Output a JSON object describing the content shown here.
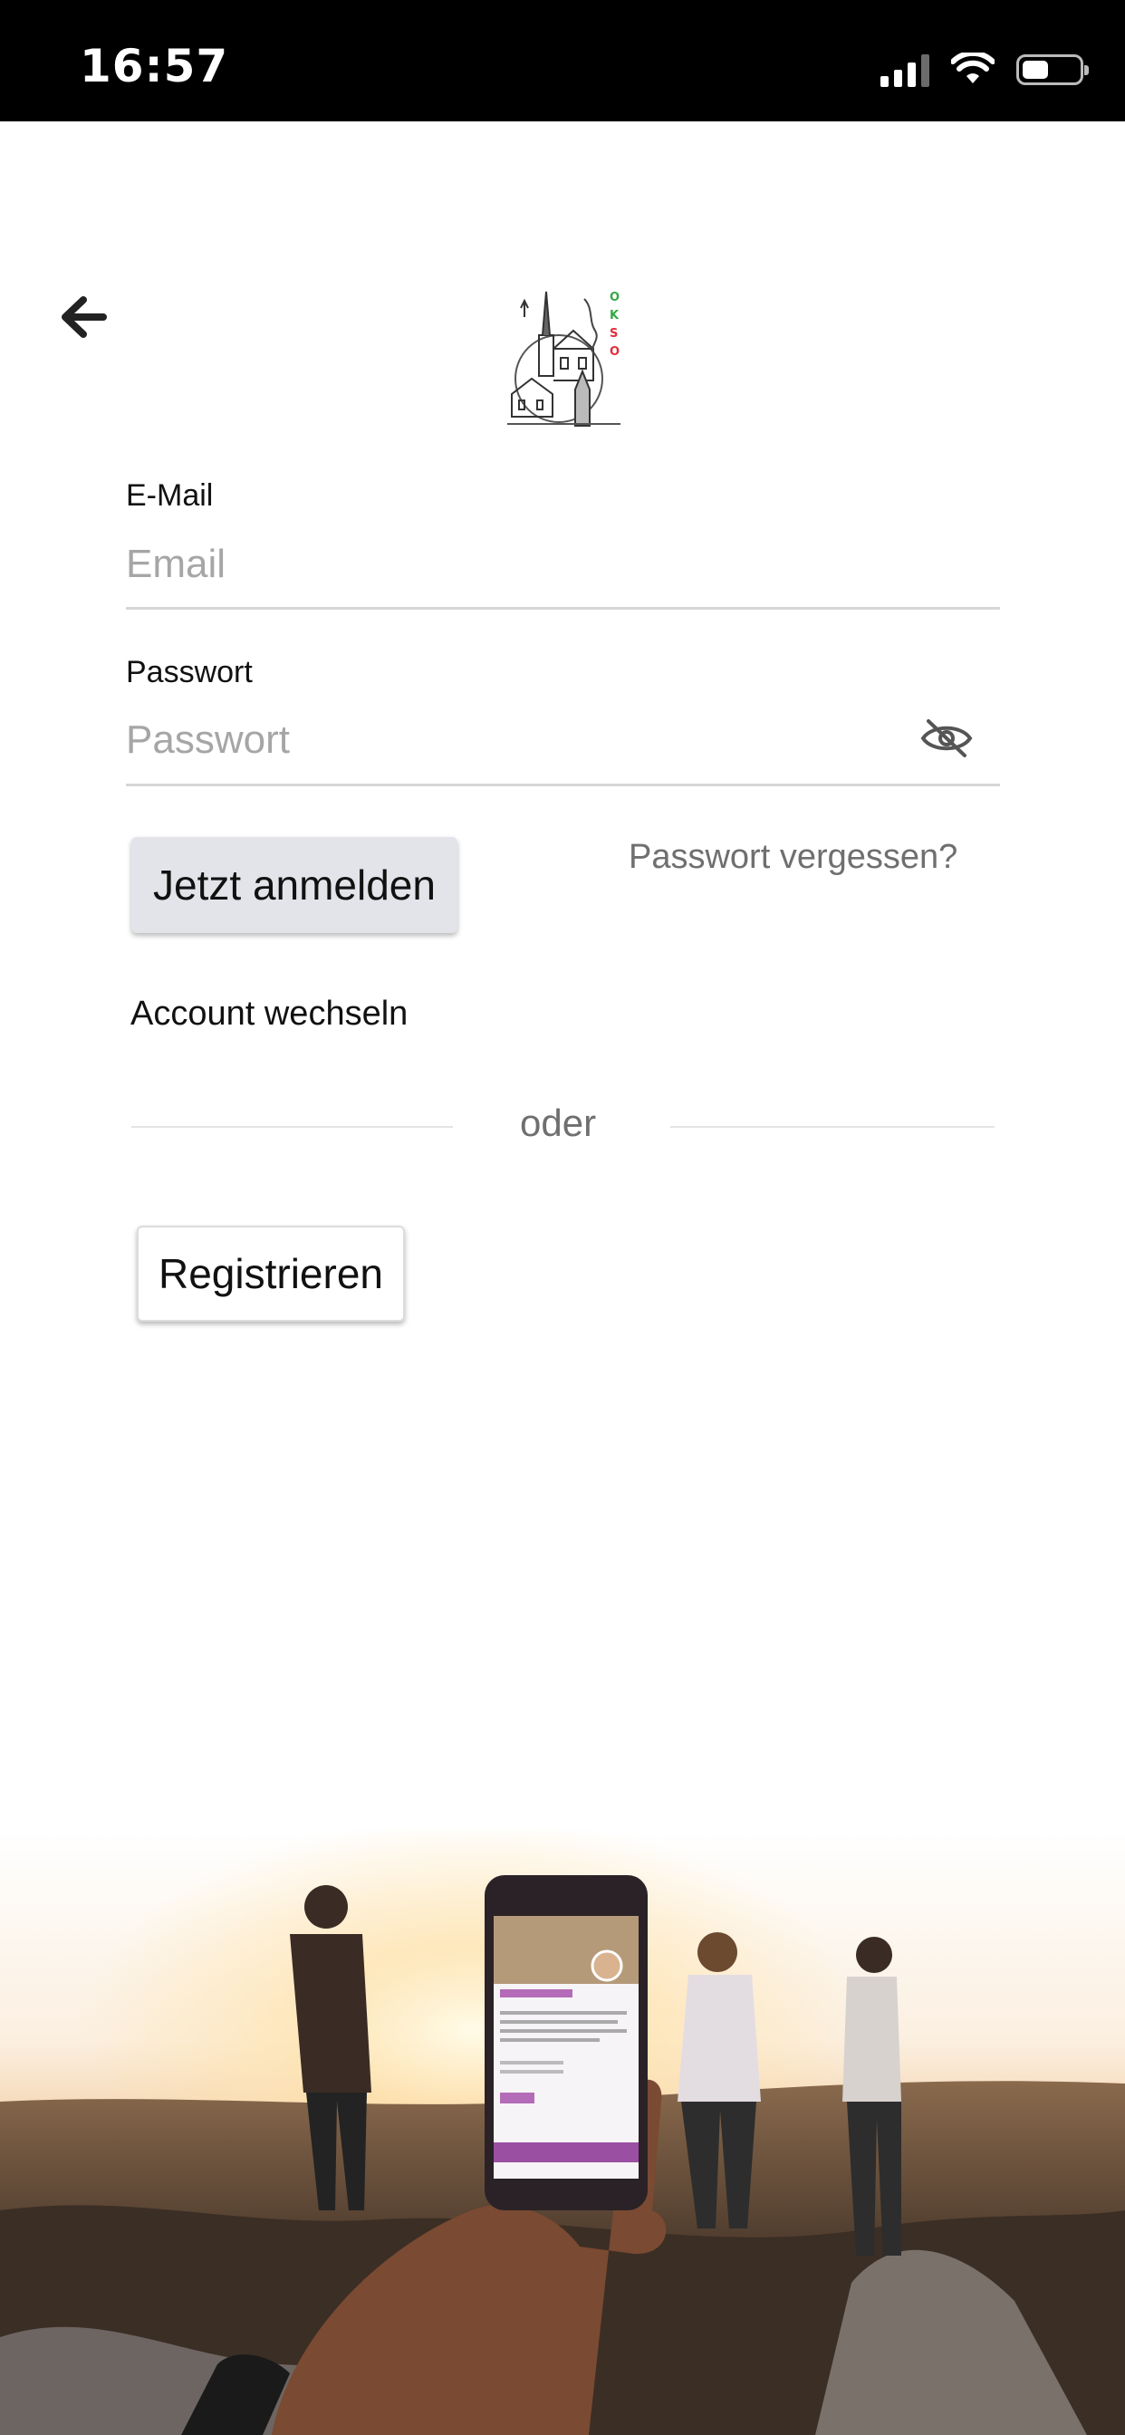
{
  "status_bar": {
    "time": "16:57",
    "signal_icon": "cellular-signal-icon",
    "wifi_icon": "wifi-icon",
    "battery_icon": "battery-icon"
  },
  "header": {
    "back_icon": "arrow-left-icon",
    "logo_letters": "OKSO"
  },
  "form": {
    "email_label": "E-Mail",
    "email_placeholder": "Email",
    "email_value": "",
    "password_label": "Passwort",
    "password_placeholder": "Passwort",
    "password_value": "",
    "password_toggle_icon": "eye-slash-icon",
    "login_button": "Jetzt anmelden",
    "forgot_password": "Passwort vergessen?",
    "switch_account": "Account wechseln",
    "divider_text": "oder",
    "register_button": "Registrieren"
  },
  "colors": {
    "button_bg": "#e2e4e9",
    "muted_text": "#6f6f6f",
    "logo_green": "#35a845",
    "logo_red": "#e02d3c"
  }
}
